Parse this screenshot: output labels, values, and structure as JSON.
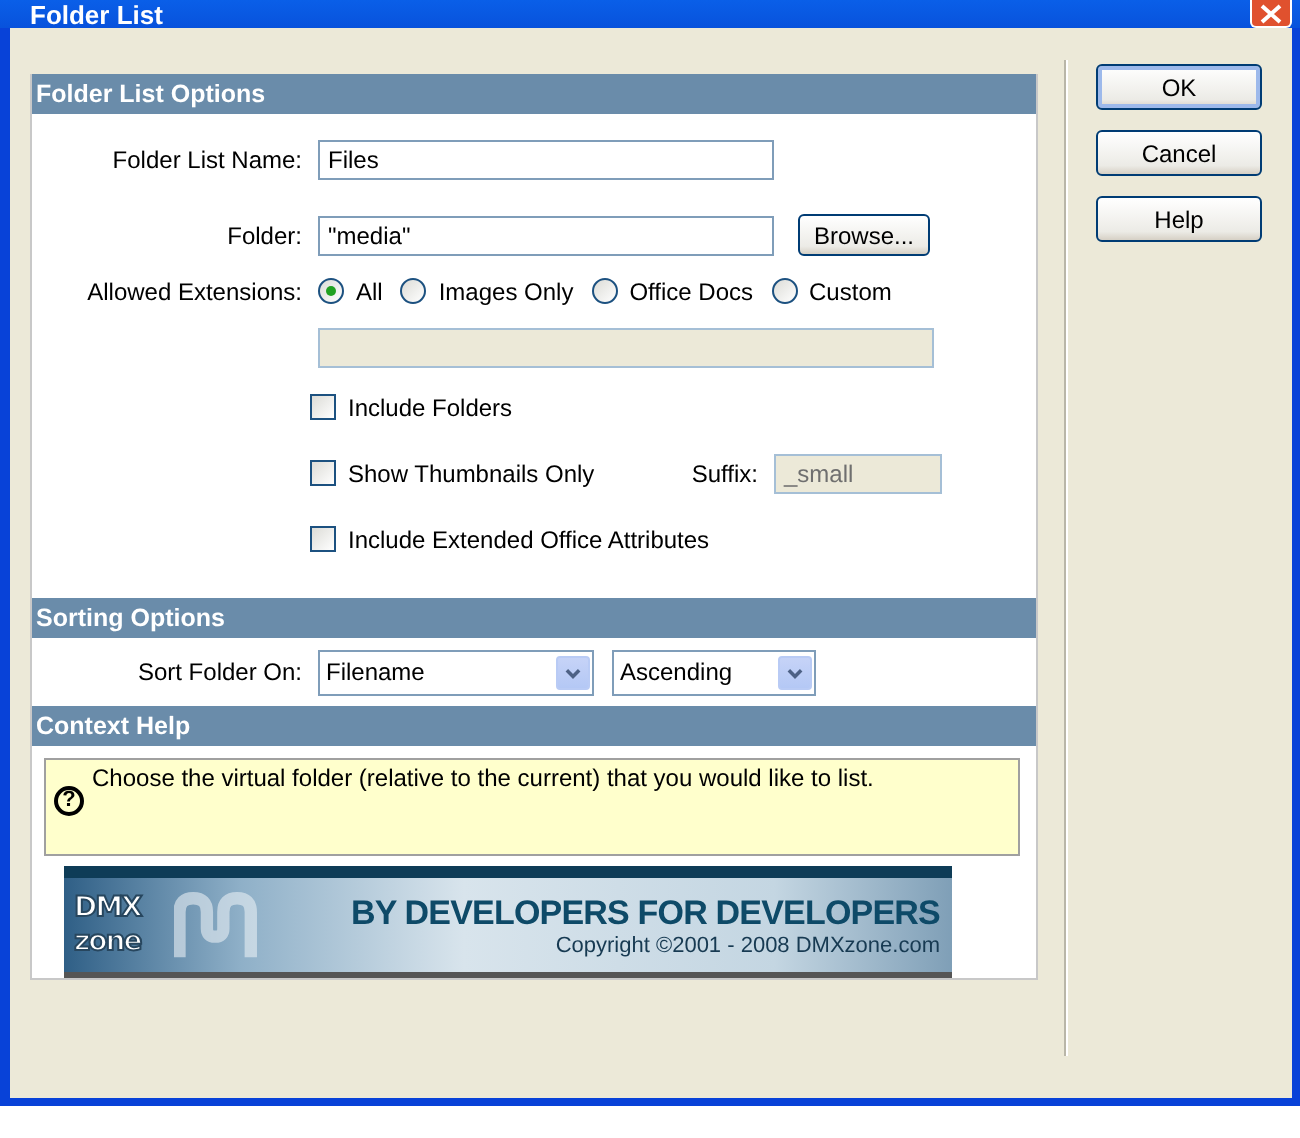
{
  "window": {
    "title": "Folder List"
  },
  "folder_list_options": {
    "heading": "Folder List Options",
    "name_label": "Folder List Name:",
    "name_value": "Files",
    "folder_label": "Folder:",
    "folder_value": "\"media\"",
    "browse_button": "Browse...",
    "extensions_label": "Allowed Extensions:",
    "extensions": [
      {
        "label": "All",
        "selected": true
      },
      {
        "label": "Images Only",
        "selected": false
      },
      {
        "label": "Office Docs",
        "selected": false
      },
      {
        "label": "Custom",
        "selected": false
      }
    ],
    "custom_field": {
      "disabled": true
    },
    "options": [
      {
        "label": "Include Folders",
        "checked": false
      },
      {
        "label": "Show Thumbnails Only",
        "checked": false,
        "suffix": {
          "label": "Suffix:",
          "value": "_small",
          "disabled": true
        }
      },
      {
        "label": "Include Extended Office Attributes",
        "checked": false
      }
    ]
  },
  "sorting_options": {
    "heading": "Sorting Options",
    "label": "Sort Folder On:",
    "selects": [
      {
        "value": "Filename"
      },
      {
        "value": "Ascending"
      }
    ]
  },
  "context_help": {
    "heading": "Context Help",
    "icon": "?",
    "text": "Choose the virtual folder (relative to the current) that you would like to list."
  },
  "banner": {
    "logo_top": "DMX",
    "logo_bottom": "zone",
    "tagline": "BY DEVELOPERS FOR DEVELOPERS",
    "copyright": "Copyright ©2001 - 2008 DMXzone.com"
  },
  "buttons": [
    {
      "label": "OK",
      "default": true
    },
    {
      "label": "Cancel",
      "default": false
    },
    {
      "label": "Help",
      "default": false
    }
  ]
}
